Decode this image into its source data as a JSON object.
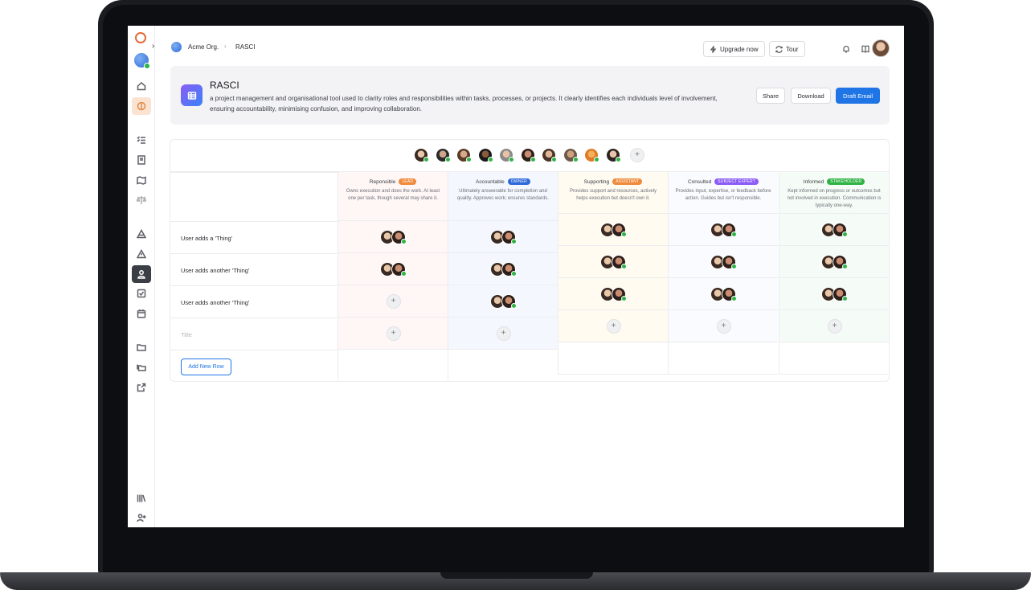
{
  "breadcrumb": {
    "org": "Acme Org.",
    "separator": "›",
    "page": "RASCI"
  },
  "topbar": {
    "upgrade_label": "Upgrade now",
    "tour_label": "Tour"
  },
  "header": {
    "title": "RASCI",
    "description": "a project management and organisational tool used to clarity roles and responsibilities within tasks, processes, or projects. It clearly identifies each individuals level of involvement, ensuring accountability, minimising confusion, and improving collaboration.",
    "share_label": "Share",
    "download_label": "Download",
    "draft_email_label": "Draft Email"
  },
  "columns": [
    {
      "title": "Reponsible",
      "badge": "LEAD",
      "badge_color": "#f08a3c",
      "bg": "#fff6f6",
      "description": "Owns execution and does the work. At least one per task, though several may share it."
    },
    {
      "title": "Accountable",
      "badge": "OWNER",
      "badge_color": "#2f6ad8",
      "bg": "#f4f8fe",
      "description": "Ultimately answerable for completion and quality. Approves work; ensures standards."
    },
    {
      "title": "Supporting",
      "badge": "ASSISTANT",
      "badge_color": "#f08a3c",
      "bg": "#fffbf1",
      "description": "Provides support and resources, actively helps execution but doesn't own it."
    },
    {
      "title": "Consulted",
      "badge": "SUBJECT EXPERT",
      "badge_color": "#8b5cf6",
      "bg": "#fafbfe",
      "description": "Provides input, expertise, or feedback before action. Guides but isn't responsible."
    },
    {
      "title": "Informed",
      "badge": "STAKEHOLDER",
      "badge_color": "#2fb344",
      "bg": "#f5fcf7",
      "description": "Kept informed on progress or outcomes but not involved in execution. Communication is typically one-way."
    }
  ],
  "rows": [
    {
      "label": "User adds a 'Thing'"
    },
    {
      "label": "User adds another 'Thing'"
    },
    {
      "label": "User adds another 'Thing'"
    }
  ],
  "new_row_placeholder": "Title",
  "add_row_label": "Add New Row",
  "add_symbol": "+"
}
